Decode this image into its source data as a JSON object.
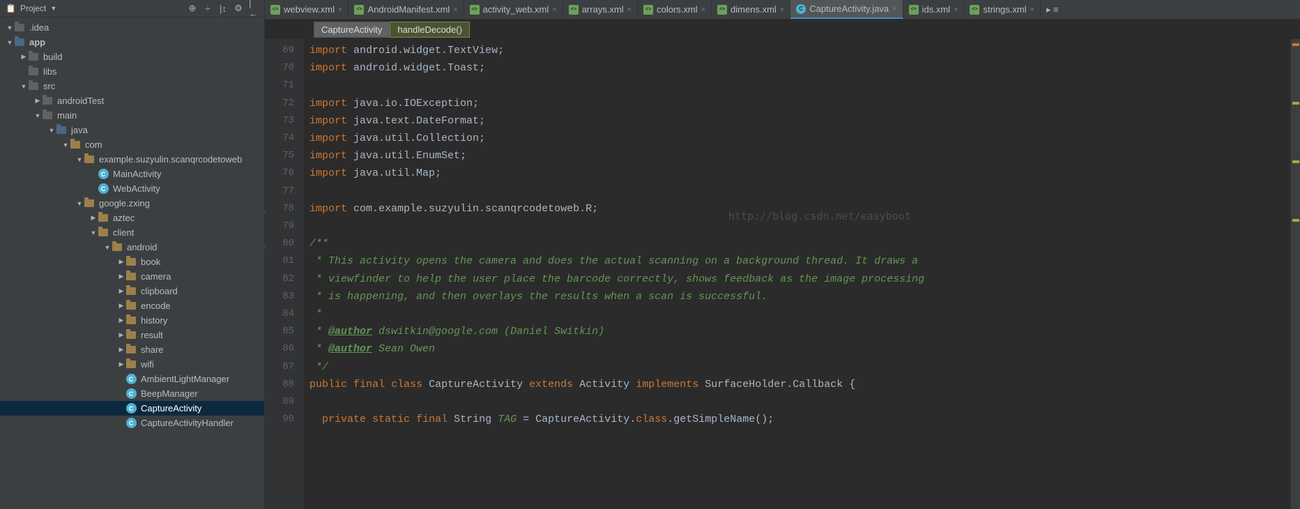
{
  "sidebar": {
    "title": "Project",
    "actions": [
      "target-icon",
      "divide-icon",
      "split-icon",
      "gear-icon",
      "collapse-icon"
    ],
    "tree": [
      {
        "depth": 0,
        "arrow": "down",
        "icon": "folder",
        "label": ".idea"
      },
      {
        "depth": 0,
        "arrow": "down",
        "icon": "folder-mod",
        "label": "app",
        "bold": true
      },
      {
        "depth": 1,
        "arrow": "right",
        "icon": "folder",
        "label": "build"
      },
      {
        "depth": 1,
        "arrow": "none",
        "icon": "folder",
        "label": "libs"
      },
      {
        "depth": 1,
        "arrow": "down",
        "icon": "folder",
        "label": "src"
      },
      {
        "depth": 2,
        "arrow": "right",
        "icon": "folder",
        "label": "androidTest"
      },
      {
        "depth": 2,
        "arrow": "down",
        "icon": "folder",
        "label": "main"
      },
      {
        "depth": 3,
        "arrow": "down",
        "icon": "folder-mod",
        "label": "java"
      },
      {
        "depth": 4,
        "arrow": "down",
        "icon": "folder-pkg",
        "label": "com"
      },
      {
        "depth": 5,
        "arrow": "down",
        "icon": "folder-pkg",
        "label": "example.suzyulin.scanqrcodetoweb"
      },
      {
        "depth": 6,
        "arrow": "none",
        "icon": "class",
        "label": "MainActivity",
        "badge": "a"
      },
      {
        "depth": 6,
        "arrow": "none",
        "icon": "class",
        "label": "WebActivity",
        "badge": "a"
      },
      {
        "depth": 5,
        "arrow": "down",
        "icon": "folder-pkg",
        "label": "google.zxing"
      },
      {
        "depth": 6,
        "arrow": "right",
        "icon": "folder-pkg",
        "label": "aztec"
      },
      {
        "depth": 6,
        "arrow": "down",
        "icon": "folder-pkg",
        "label": "client"
      },
      {
        "depth": 7,
        "arrow": "down",
        "icon": "folder-pkg",
        "label": "android"
      },
      {
        "depth": 8,
        "arrow": "right",
        "icon": "folder-pkg",
        "label": "book"
      },
      {
        "depth": 8,
        "arrow": "right",
        "icon": "folder-pkg",
        "label": "camera"
      },
      {
        "depth": 8,
        "arrow": "right",
        "icon": "folder-pkg",
        "label": "clipboard"
      },
      {
        "depth": 8,
        "arrow": "right",
        "icon": "folder-pkg",
        "label": "encode"
      },
      {
        "depth": 8,
        "arrow": "right",
        "icon": "folder-pkg",
        "label": "history"
      },
      {
        "depth": 8,
        "arrow": "right",
        "icon": "folder-pkg",
        "label": "result"
      },
      {
        "depth": 8,
        "arrow": "right",
        "icon": "folder-pkg",
        "label": "share"
      },
      {
        "depth": 8,
        "arrow": "right",
        "icon": "folder-pkg",
        "label": "wifi"
      },
      {
        "depth": 8,
        "arrow": "none",
        "icon": "class",
        "label": "AmbientLightManager",
        "badge": "a"
      },
      {
        "depth": 8,
        "arrow": "none",
        "icon": "class",
        "label": "BeepManager",
        "badge": "a"
      },
      {
        "depth": 8,
        "arrow": "none",
        "icon": "class",
        "label": "CaptureActivity",
        "badge": "a",
        "selected": true
      },
      {
        "depth": 8,
        "arrow": "none",
        "icon": "class",
        "label": "CaptureActivityHandler",
        "badge": "a"
      }
    ]
  },
  "tabs": [
    {
      "type": "xml",
      "label": "webview.xml",
      "partial": true
    },
    {
      "type": "xml",
      "label": "AndroidManifest.xml"
    },
    {
      "type": "xml",
      "label": "activity_web.xml"
    },
    {
      "type": "xml",
      "label": "arrays.xml"
    },
    {
      "type": "xml",
      "label": "colors.xml"
    },
    {
      "type": "xml",
      "label": "dimens.xml"
    },
    {
      "type": "java",
      "label": "CaptureActivity.java",
      "active": true
    },
    {
      "type": "xml",
      "label": "ids.xml"
    },
    {
      "type": "xml",
      "label": "strings.xml"
    }
  ],
  "breadcrumb": [
    {
      "label": "CaptureActivity",
      "style": "dim"
    },
    {
      "label": "handleDecode()",
      "style": "active"
    }
  ],
  "watermark": "http://blog.csdn.net/easyboot",
  "code": {
    "start": 69,
    "lines": [
      {
        "n": 69,
        "html": "<span class='kw'>import</span> <span class='pkg'>android.widget.TextView</span>;"
      },
      {
        "n": 70,
        "html": "<span class='kw'>import</span> <span class='pkg'>android.widget.Toast</span>;"
      },
      {
        "n": 71,
        "html": ""
      },
      {
        "n": 72,
        "html": "<span class='kw'>import</span> <span class='pkg'>java.io.IOException</span>;"
      },
      {
        "n": 73,
        "html": "<span class='kw'>import</span> <span class='pkg'>java.text.DateFormat</span>;"
      },
      {
        "n": 74,
        "html": "<span class='kw'>import</span> <span class='pkg'>java.util.Collection</span>;"
      },
      {
        "n": 75,
        "html": "<span class='kw'>import</span> <span class='pkg'>java.util.EnumSet</span>;"
      },
      {
        "n": 76,
        "html": "<span class='kw'>import</span> <span class='pkg'>java.util.Map</span>;"
      },
      {
        "n": 77,
        "html": ""
      },
      {
        "n": 78,
        "html": "<span class='kw'>import</span> <span class='pkg'>com.example.suzyulin.scanqrcodetoweb.R</span>;",
        "fold": true
      },
      {
        "n": 79,
        "html": ""
      },
      {
        "n": 80,
        "html": "<span class='doc'>/**</span>",
        "fold": true
      },
      {
        "n": 81,
        "html": "<span class='doc'> * This activity opens the camera and does the actual scanning on a background thread. It draws a</span>"
      },
      {
        "n": 82,
        "html": "<span class='doc'> * viewfinder to help the user place the barcode correctly, shows feedback as the image processing</span>"
      },
      {
        "n": 83,
        "html": "<span class='doc'> * is happening, and then overlays the results when a scan is successful.</span>"
      },
      {
        "n": 84,
        "html": "<span class='doc'> *</span>"
      },
      {
        "n": 85,
        "html": "<span class='doc'> * </span><span class='docu'>@author</span><span class='doc'> dswitkin@google.com (Daniel Switkin)</span>"
      },
      {
        "n": 86,
        "html": "<span class='doc'> * </span><span class='docu'>@author</span><span class='doc'> Sean Owen</span>"
      },
      {
        "n": 87,
        "html": "<span class='doc'> */</span>"
      },
      {
        "n": 88,
        "html": "<span class='kw'>public</span> <span class='kw'>final</span> <span class='kw'>class</span> <span class='id'>CaptureActivity</span> <span class='kw'>extends</span> <span class='id'>Activity</span> <span class='kw'>implements</span> <span class='id'>SurfaceHolder.Callback</span> {",
        "badge": true
      },
      {
        "n": 89,
        "html": ""
      },
      {
        "n": 90,
        "html": "  <span class='kw'>private</span> <span class='kw'>static</span> <span class='kw'>final</span> <span class='id'>String</span> <span class='doc'>TAG</span> = <span class='id'>CaptureActivity</span>.<span class='kw'>class</span>.<span class='id'>getSimpleName</span>();"
      }
    ]
  }
}
